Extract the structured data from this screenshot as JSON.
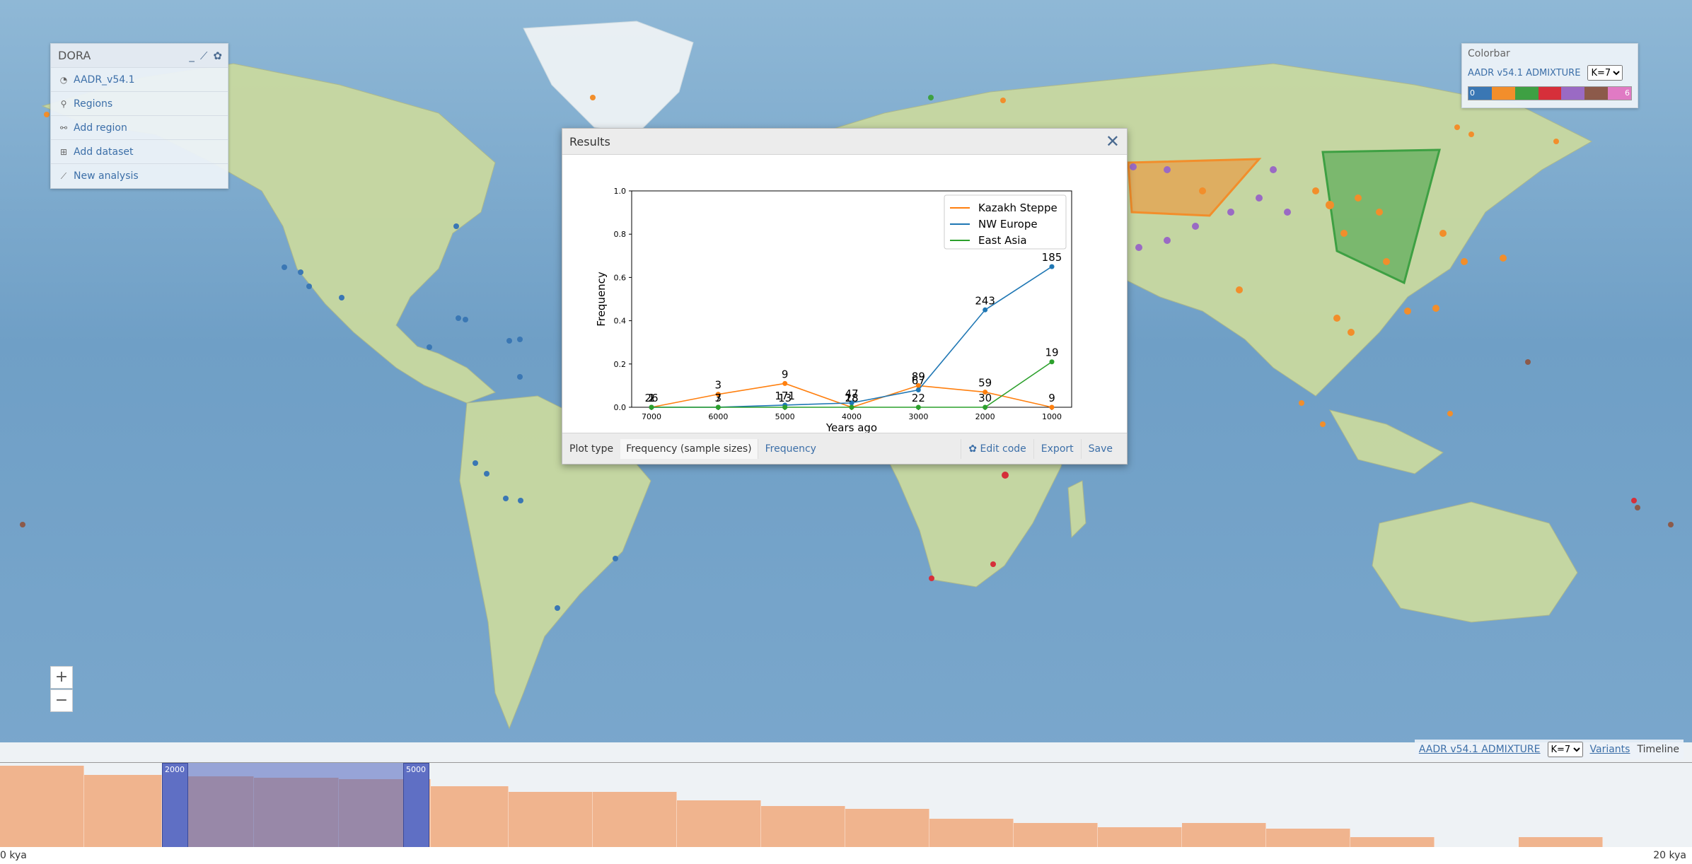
{
  "app": {
    "title": "DORA",
    "icons": [
      "minimize-icon",
      "chart-icon",
      "gear-icon"
    ]
  },
  "sidebar": {
    "items": [
      {
        "label": "AADR_v54.1",
        "icon": "dataset-icon"
      },
      {
        "label": "Regions",
        "icon": "pin-icon"
      },
      {
        "label": "Add region",
        "icon": "add-region-icon"
      },
      {
        "label": "Add dataset",
        "icon": "add-dataset-icon"
      },
      {
        "label": "New analysis",
        "icon": "analysis-icon"
      }
    ]
  },
  "colorbar": {
    "title": "Colorbar",
    "dataset": "AADR v54.1 ADMIXTURE",
    "k_selected": "K=7",
    "first_label": "0",
    "last_label": "6",
    "colors": [
      "#3a77b4",
      "#f28e2b",
      "#3ea043",
      "#d62f3a",
      "#9a6ac4",
      "#8c5a4a",
      "#e07ac4"
    ]
  },
  "results": {
    "title": "Results",
    "footer": {
      "plot_type_label": "Plot type",
      "plot_type_value": "Frequency (sample sizes)",
      "plot_type_alt": "Frequency",
      "edit_code": "Edit code",
      "export": "Export",
      "save": "Save"
    }
  },
  "chart_data": {
    "type": "line",
    "x": [
      7000,
      6000,
      5000,
      4000,
      3000,
      2000,
      1000
    ],
    "x_ticks": [
      "7000",
      "6000",
      "5000",
      "4000",
      "3000",
      "2000",
      "1000"
    ],
    "xlabel": "Years ago",
    "ylabel": "Frequency",
    "ylim": [
      0.0,
      1.0
    ],
    "y_ticks": [
      "0.0",
      "0.2",
      "0.4",
      "0.6",
      "0.8",
      "1.0"
    ],
    "legend_position": "top-right",
    "series": [
      {
        "name": "Kazakh Steppe",
        "color": "#ff7f0e",
        "values": [
          0.0,
          0.06,
          0.11,
          0.0,
          0.1,
          0.07,
          0.0
        ],
        "labels": [
          "2",
          "3",
          "9",
          "28",
          "89",
          "59",
          "9"
        ]
      },
      {
        "name": "NW Europe",
        "color": "#1f77b4",
        "values": [
          0.0,
          0.0,
          0.01,
          0.02,
          0.08,
          0.45,
          0.65
        ],
        "labels": [
          "26",
          "7",
          "171",
          "47",
          "67",
          "243",
          "185"
        ]
      },
      {
        "name": "East Asia",
        "color": "#2ca02c",
        "values": [
          0.0,
          0.0,
          0.0,
          0.0,
          0.0,
          0.0,
          0.21
        ],
        "labels": [
          "1",
          "3",
          "13",
          "18",
          "22",
          "30",
          "19"
        ]
      }
    ]
  },
  "zoom": {
    "in": "+",
    "out": "−"
  },
  "bottom_controls": {
    "dataset": "AADR v54.1 ADMIXTURE",
    "k_selected": "K=7",
    "tab_variants": "Variants",
    "tab_timeline": "Timeline"
  },
  "timeline": {
    "left_axis": "0 kya",
    "right_axis": "20 kya",
    "handle_start": "2000",
    "handle_end": "5000"
  }
}
